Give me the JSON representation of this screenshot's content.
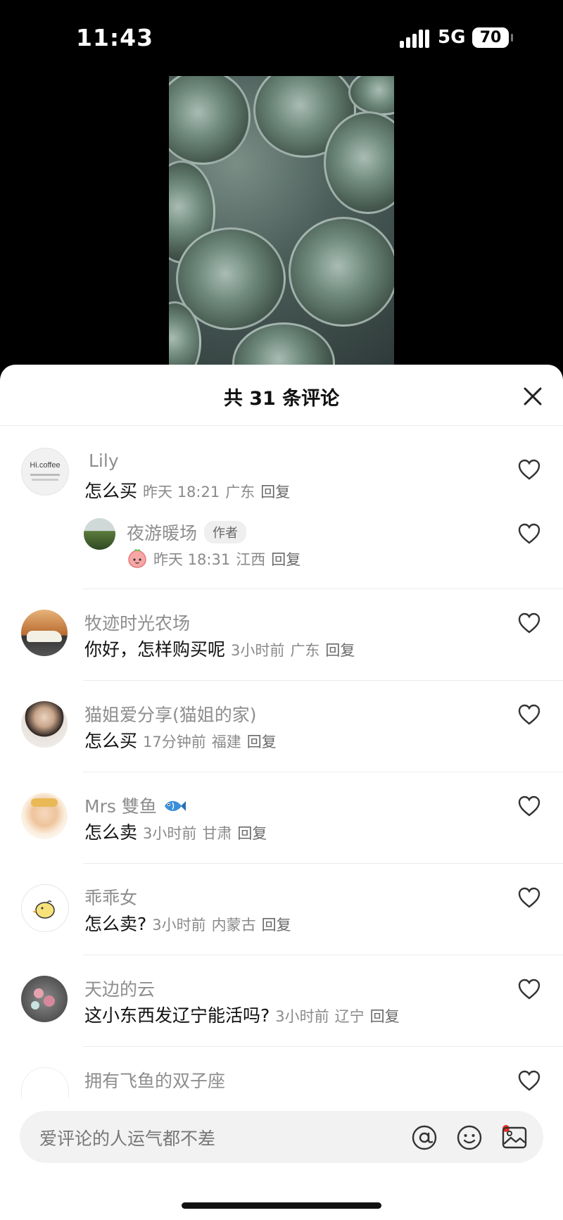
{
  "status_bar": {
    "time": "11:43",
    "network": "5G",
    "battery": "70"
  },
  "sheet": {
    "title": "共 31 条评论"
  },
  "comments": [
    {
      "username": "Lily",
      "text": "怎么买",
      "time": "昨天 18:21",
      "location": "广东",
      "reply": "回复",
      "avatar_text": "Hi.coffee"
    },
    {
      "username": "夜游暖场",
      "badge": "作者",
      "text": "",
      "time": "昨天 18:31",
      "location": "江西",
      "reply": "回复"
    },
    {
      "username": "牧迹时光农场",
      "text": "你好，怎样购买呢",
      "time": "3小时前",
      "location": "广东",
      "reply": "回复"
    },
    {
      "username": "猫姐爱分享(猫姐的家)",
      "text": "怎么买",
      "time": "17分钟前",
      "location": "福建",
      "reply": "回复"
    },
    {
      "username": "Mrs 雙鱼",
      "text": "怎么卖",
      "time": "3小时前",
      "location": "甘肃",
      "reply": "回复"
    },
    {
      "username": "乖乖女",
      "text": "怎么卖?",
      "time": "3小时前",
      "location": "内蒙古",
      "reply": "回复"
    },
    {
      "username": "天边的云",
      "text": "这小东西发辽宁能活吗?",
      "time": "3小时前",
      "location": "辽宁",
      "reply": "回复"
    },
    {
      "username": "拥有飞鱼的双子座"
    }
  ],
  "input": {
    "placeholder": "爱评论的人运气都不差"
  },
  "colors": {
    "accent_red": "#ee2a24",
    "background": "#000000",
    "sheet": "#ffffff"
  }
}
